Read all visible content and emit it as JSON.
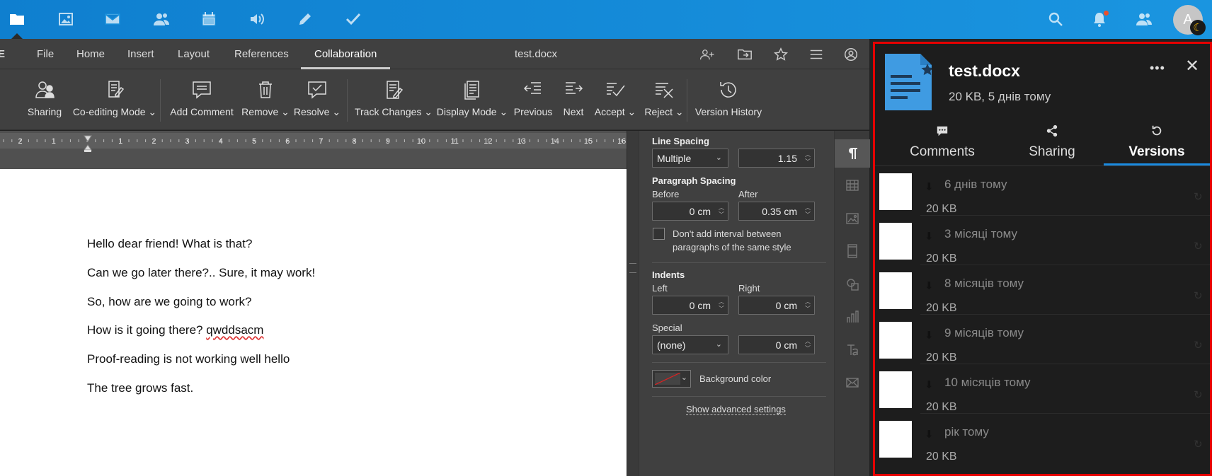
{
  "topbar": {
    "apps": [
      {
        "name": "files-icon",
        "active": true
      },
      {
        "name": "photos-icon"
      },
      {
        "name": "mail-icon"
      },
      {
        "name": "contacts-icon"
      },
      {
        "name": "calendar-icon"
      },
      {
        "name": "talk-icon"
      },
      {
        "name": "notes-icon"
      },
      {
        "name": "tasks-icon"
      }
    ],
    "right_icons": [
      "search-icon",
      "notifications-icon",
      "contacts-menu-icon"
    ],
    "avatar_letter": "A",
    "accent": "#0082c9"
  },
  "editor": {
    "menu": {
      "logo_partial": "E",
      "tabs": [
        "File",
        "Home",
        "Insert",
        "Layout",
        "References",
        "Collaboration"
      ],
      "active_tab": "Collaboration",
      "document_title": "test.docx"
    },
    "ribbon": {
      "sharing": "Sharing",
      "coediting": "Co-editing Mode",
      "add_comment": "Add Comment",
      "remove": "Remove",
      "resolve": "Resolve",
      "track_changes": "Track Changes",
      "display_mode": "Display Mode",
      "previous": "Previous",
      "next": "Next",
      "accept": "Accept",
      "reject": "Reject",
      "version_history": "Version History"
    },
    "ruler_labels": [
      "2",
      "1",
      "1",
      "2",
      "3",
      "4",
      "5",
      "6",
      "7",
      "8",
      "9",
      "10",
      "11",
      "12",
      "13",
      "14",
      "15",
      "16"
    ],
    "document": {
      "lines": [
        "Hello dear friend! What is that?",
        "Can we go later there?.. Sure, it may work!",
        "So, how are we going to work?",
        "How is it going there? ",
        "Proof-reading is not working well hello",
        "The tree grows fast."
      ],
      "misspelled": "qwddsacm"
    },
    "paragraph_settings": {
      "line_spacing_label": "Line Spacing",
      "line_spacing_mode": "Multiple",
      "line_spacing_value": "1.15",
      "paragraph_spacing_label": "Paragraph Spacing",
      "before_label": "Before",
      "before_value": "0 cm",
      "after_label": "After",
      "after_value": "0.35 cm",
      "no_interval_label": "Don't add interval between paragraphs of the same style",
      "indents_label": "Indents",
      "left_label": "Left",
      "left_value": "0 cm",
      "right_label": "Right",
      "right_value": "0 cm",
      "special_label": "Special",
      "special_value": "(none)",
      "special_amount": "0 cm",
      "background_color_label": "Background color",
      "advanced_link": "Show advanced settings"
    },
    "right_strip": [
      "paragraph-icon",
      "table-icon",
      "image-icon",
      "header-footer-icon",
      "shape-icon",
      "chart-icon",
      "text-art-icon",
      "mail-merge-icon"
    ]
  },
  "sidebar": {
    "file_name": "test.docx",
    "file_meta": "20 KB, 5 днів тому",
    "tabs": [
      {
        "label": "Comments",
        "icon": "comment-icon"
      },
      {
        "label": "Sharing",
        "icon": "share-icon"
      },
      {
        "label": "Versions",
        "icon": "history-icon"
      }
    ],
    "active_tab": "Versions",
    "versions": [
      {
        "date": "6 днів тому",
        "size": "20 KB"
      },
      {
        "date": "3 місяці тому",
        "size": "20 KB"
      },
      {
        "date": "8 місяців тому",
        "size": "20 KB"
      },
      {
        "date": "9 місяців тому",
        "size": "20 KB"
      },
      {
        "date": "10 місяців тому",
        "size": "20 KB"
      },
      {
        "date": "рік тому",
        "size": "20 KB"
      }
    ],
    "highlight_color": "#e50000"
  }
}
